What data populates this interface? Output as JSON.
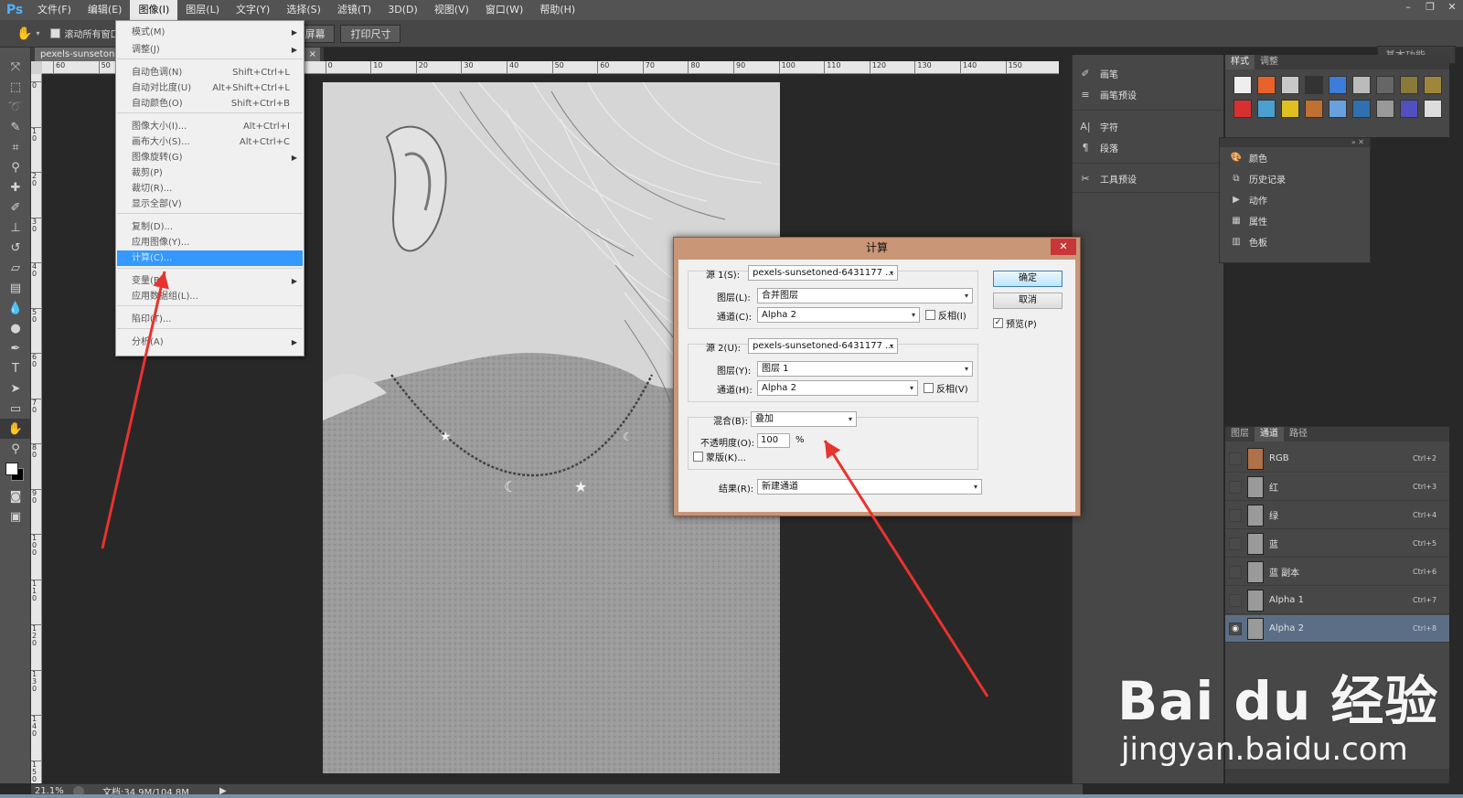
{
  "app": {
    "logo": "Ps"
  },
  "menubar": {
    "items": [
      "文件(F)",
      "编辑(E)",
      "图像(I)",
      "图层(L)",
      "文字(Y)",
      "选择(S)",
      "滤镜(T)",
      "3D(D)",
      "视图(V)",
      "窗口(W)",
      "帮助(H)"
    ],
    "active_index": 2
  },
  "window_controls": [
    "–",
    "❐",
    "✕"
  ],
  "options_bar": {
    "scroll_all_label": "滚动所有窗口",
    "fit_screen_label": "屏幕",
    "print_size_label": "打印尺寸",
    "workspace_label": "基本功能"
  },
  "document": {
    "tab_title": "pexels-sunsetoned",
    "zoom": "21.1%",
    "doc_info": "文档:34.9M/104.8M"
  },
  "ruler": {
    "h_labels": [
      "60",
      "50",
      "40",
      "30",
      "20",
      "10",
      "0",
      "10",
      "20",
      "30",
      "40",
      "50",
      "60",
      "70",
      "80",
      "90",
      "100",
      "110",
      "120",
      "130",
      "140",
      "150"
    ],
    "v_labels": [
      "0",
      "1 0",
      "2 0",
      "3 0",
      "4 0",
      "5 0",
      "6 0",
      "7 0",
      "8 0",
      "9 0",
      "1 0 0",
      "1 1 0",
      "1 2 0",
      "1 3 0",
      "1 4 0",
      "1 5 0"
    ]
  },
  "image_menu": {
    "items": [
      {
        "label": "模式(M)",
        "shortcut": "",
        "submenu": true
      },
      {
        "label": "调整(J)",
        "shortcut": "",
        "submenu": true
      },
      {
        "label": "自动色调(N)",
        "shortcut": "Shift+Ctrl+L"
      },
      {
        "label": "自动对比度(U)",
        "shortcut": "Alt+Shift+Ctrl+L"
      },
      {
        "label": "自动颜色(O)",
        "shortcut": "Shift+Ctrl+B"
      },
      {
        "label": "图像大小(I)...",
        "shortcut": "Alt+Ctrl+I"
      },
      {
        "label": "画布大小(S)...",
        "shortcut": "Alt+Ctrl+C"
      },
      {
        "label": "图像旋转(G)",
        "shortcut": "",
        "submenu": true
      },
      {
        "label": "裁剪(P)",
        "shortcut": ""
      },
      {
        "label": "裁切(R)...",
        "shortcut": ""
      },
      {
        "label": "显示全部(V)",
        "shortcut": ""
      },
      {
        "label": "复制(D)...",
        "shortcut": ""
      },
      {
        "label": "应用图像(Y)...",
        "shortcut": ""
      },
      {
        "label": "计算(C)...",
        "shortcut": ""
      },
      {
        "label": "变量(B)",
        "shortcut": "",
        "submenu": true
      },
      {
        "label": "应用数据组(L)...",
        "shortcut": ""
      },
      {
        "label": "陷印(T)...",
        "shortcut": ""
      },
      {
        "label": "分析(A)",
        "shortcut": "",
        "submenu": true
      }
    ]
  },
  "right_panels": {
    "dock1": [
      "画笔",
      "画笔预设",
      "字符",
      "段落",
      "工具预设"
    ],
    "styles_tabs": [
      "样式",
      "调整"
    ],
    "float_panel": [
      "颜色",
      "历史记录",
      "动作",
      "属性",
      "色板"
    ],
    "layers_tabs": [
      "图层",
      "通道",
      "路径"
    ],
    "channels": [
      {
        "name": "RGB",
        "shortcut": "Ctrl+2"
      },
      {
        "name": "红",
        "shortcut": "Ctrl+3"
      },
      {
        "name": "绿",
        "shortcut": "Ctrl+4"
      },
      {
        "name": "蓝",
        "shortcut": "Ctrl+5"
      },
      {
        "name": "蓝 副本",
        "shortcut": "Ctrl+6"
      },
      {
        "name": "Alpha 1",
        "shortcut": "Ctrl+7"
      },
      {
        "name": "Alpha 2",
        "shortcut": "Ctrl+8"
      }
    ]
  },
  "dialog": {
    "title": "计算",
    "close": "✕",
    "source1_label": "源 1(S):",
    "source1_value": "pexels-sunsetoned-6431177 ...",
    "layer1_label": "图层(L):",
    "layer1_value": "合并图层",
    "channel1_label": "通道(C):",
    "channel1_value": "Alpha 2",
    "invert1_label": "反相(I)",
    "source2_label": "源 2(U):",
    "source2_value": "pexels-sunsetoned-6431177 ...",
    "layer2_label": "图层(Y):",
    "layer2_value": "图层 1",
    "channel2_label": "通道(H):",
    "channel2_value": "Alpha 2",
    "invert2_label": "反相(V)",
    "blend_label": "混合(B):",
    "blend_value": "叠加",
    "opacity_label": "不透明度(O):",
    "opacity_value": "100",
    "opacity_unit": "%",
    "mask_label": "蒙版(K)...",
    "result_label": "结果(R):",
    "result_value": "新建通道",
    "ok_label": "确定",
    "cancel_label": "取消",
    "preview_label": "预览(P)"
  },
  "watermark": {
    "brand": "Bai du 经验",
    "url": "jingyan.baidu.com"
  }
}
